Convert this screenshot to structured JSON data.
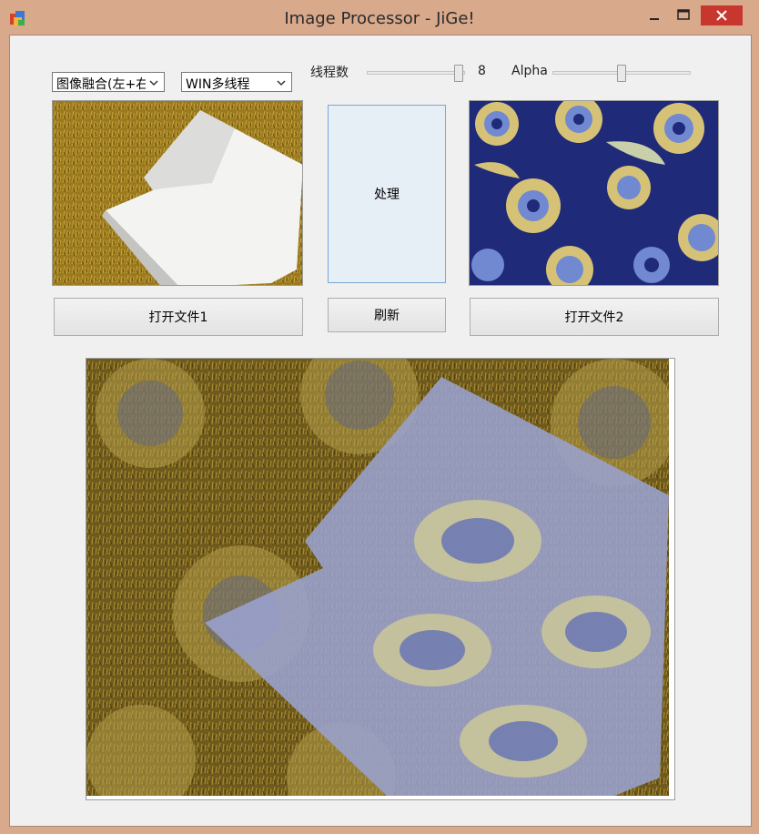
{
  "window": {
    "title": "Image Processor - JiGe!",
    "controls": {
      "minimize_icon": "minimize-icon",
      "maximize_icon": "maximize-icon",
      "close_icon": "close-icon"
    }
  },
  "toolbar": {
    "algorithm_select": {
      "value": "图像融合(左+右",
      "options_visible": [
        "图像融合(左+右"
      ]
    },
    "mode_select": {
      "value": "WIN多线程"
    },
    "thread_label": "线程数",
    "thread_value": "8",
    "alpha_label": "Alpha"
  },
  "sliders": {
    "threads": {
      "value": 8,
      "fraction": 1.0
    },
    "alpha": {
      "fraction": 0.5
    }
  },
  "buttons": {
    "process": "处理",
    "refresh": "刷新",
    "open_file_1": "打开文件1",
    "open_file_2": "打开文件2"
  },
  "images": {
    "left": "shirt-on-grass",
    "right": "abstract-pattern",
    "result": "blended-output"
  },
  "colors": {
    "titlebar_bg": "#d9a98c",
    "client_bg": "#f0f0f0",
    "close_red": "#c7372f",
    "process_button_bg": "#e6eef6"
  }
}
